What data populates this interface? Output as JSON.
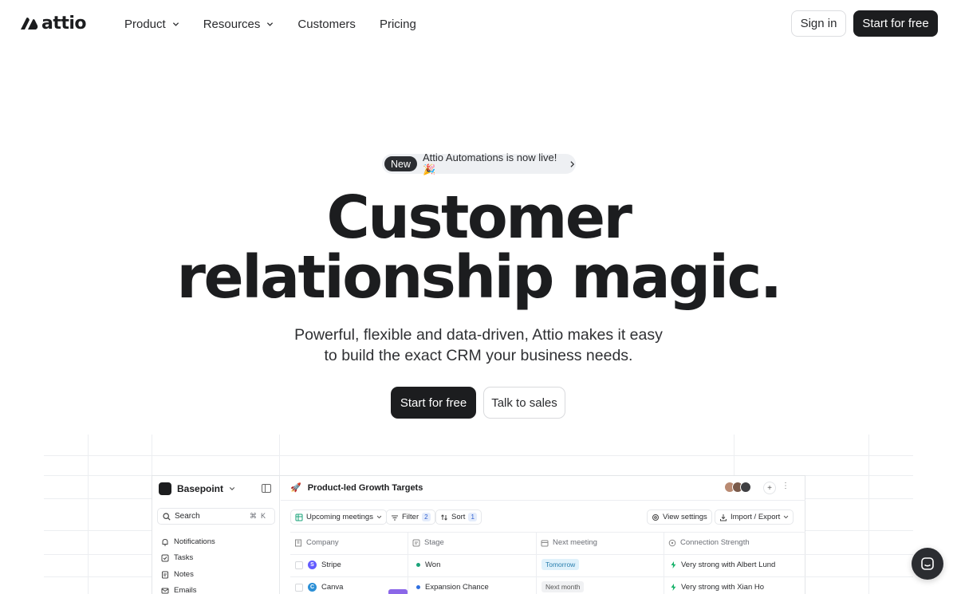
{
  "brand": {
    "name": "attio"
  },
  "nav": {
    "links": [
      {
        "label": "Product",
        "has_menu": true
      },
      {
        "label": "Resources",
        "has_menu": true
      },
      {
        "label": "Customers",
        "has_menu": false
      },
      {
        "label": "Pricing",
        "has_menu": false
      }
    ],
    "signin_label": "Sign in",
    "start_label": "Start for free"
  },
  "hero": {
    "badge_label": "New",
    "announcement": "Attio Automations is now live! 🎉",
    "headline_line1": "Customer",
    "headline_line2": "relationship magic.",
    "subhead_line1": "Powerful, flexible and data-driven, Attio makes it easy",
    "subhead_line2": "to build the exact CRM your business needs.",
    "cta_primary": "Start for free",
    "cta_secondary": "Talk to sales"
  },
  "app": {
    "workspace": "Basepoint",
    "search_label": "Search",
    "search_shortcut": "⌘K",
    "sidebar_items": [
      {
        "label": "Notifications",
        "icon": "bell-icon"
      },
      {
        "label": "Tasks",
        "icon": "checkbox-icon"
      },
      {
        "label": "Notes",
        "icon": "note-icon"
      },
      {
        "label": "Emails",
        "icon": "mail-icon"
      }
    ],
    "view_title": "Product-led Growth Targets",
    "view_emoji": "🚀",
    "toolbar": {
      "view_label": "Upcoming meetings",
      "filter_label": "Filter",
      "filter_count": "2",
      "sort_label": "Sort",
      "sort_count": "1",
      "settings_label": "View settings",
      "import_label": "Import / Export"
    },
    "columns": [
      "Company",
      "Stage",
      "Next meeting",
      "Connection Strength"
    ],
    "rows": [
      {
        "company": "Stripe",
        "logo_letter": "S",
        "logo_color": "#635bff",
        "stage": "Won",
        "stage_color": "#1aa37a",
        "meeting": "Tomorrow",
        "meeting_style": "highlight",
        "strength": "Very strong with Albert Lund"
      },
      {
        "company": "Canva",
        "logo_letter": "C",
        "logo_color": "#2b8fd6",
        "stage": "Expansion Chance",
        "stage_color": "#2f6fe0",
        "meeting": "Next month",
        "meeting_style": "muted",
        "strength": "Very strong with Xian Ho"
      }
    ]
  },
  "colors": {
    "primary_dark": "#1c1d1f",
    "accent_purple": "#8b67e8",
    "strength_green": "#19b36b"
  }
}
